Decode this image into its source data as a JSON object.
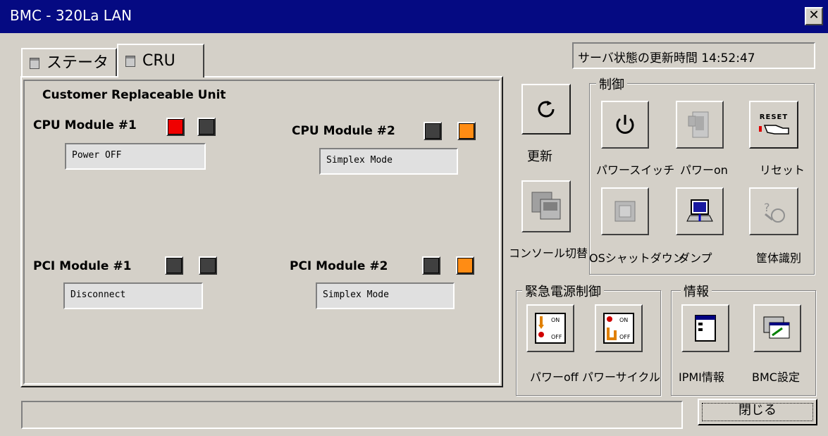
{
  "window": {
    "title": "BMC - 320La LAN",
    "close_glyph": "✕"
  },
  "tabs": [
    {
      "label": "ステータス",
      "icon": "status-tab-icon"
    },
    {
      "label": "CRU",
      "icon": "cru-tab-icon"
    }
  ],
  "cru": {
    "heading": "Customer Replaceable Unit",
    "modules": [
      {
        "name": "CPU Module #1",
        "status": "Power OFF",
        "leds": [
          "#f00000",
          "#404040"
        ]
      },
      {
        "name": "CPU Module #2",
        "status": "Simplex Mode",
        "leds": [
          "#404040",
          "#ff8c14"
        ]
      },
      {
        "name": "PCI Module #1",
        "status": "Disconnect",
        "leds": [
          "#404040",
          "#404040"
        ]
      },
      {
        "name": "PCI Module #2",
        "status": "Simplex Mode",
        "leds": [
          "#404040",
          "#ff8c14"
        ]
      }
    ]
  },
  "update_time": {
    "label": "サーバ状態の更新時間",
    "value": "14:52:47"
  },
  "refresh": {
    "label": "更新"
  },
  "console": {
    "label": "コンソール切替"
  },
  "control": {
    "title": "制御",
    "buttons": [
      {
        "label": "パワースイッチ",
        "icon": "power-icon"
      },
      {
        "label": "パワーon",
        "icon": "power-on-icon"
      },
      {
        "label": "リセット",
        "icon": "reset-icon",
        "badge": "RESET"
      },
      {
        "label": "OSシャットダウン",
        "icon": "os-shutdown-icon"
      },
      {
        "label": "ダンプ",
        "icon": "dump-icon"
      },
      {
        "label": "筐体識別",
        "icon": "chassis-identify-icon"
      }
    ]
  },
  "emergency": {
    "title": "緊急電源制御",
    "buttons": [
      {
        "label": "パワーoff",
        "icon": "power-off-switch-icon",
        "on": "ON",
        "off": "OFF"
      },
      {
        "label": "パワーサイクル",
        "icon": "power-cycle-icon",
        "on": "ON",
        "off": "OFF"
      }
    ]
  },
  "info": {
    "title": "情報",
    "buttons": [
      {
        "label": "IPMI情報",
        "icon": "ipmi-info-icon"
      },
      {
        "label": "BMC設定",
        "icon": "bmc-settings-icon"
      }
    ]
  },
  "status_bar": {
    "text": ""
  },
  "close_button": {
    "label": "閉じる"
  }
}
